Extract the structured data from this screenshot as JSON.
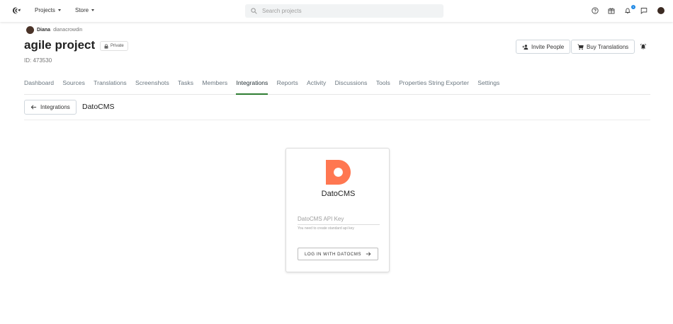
{
  "topbar": {
    "menus": [
      {
        "label": "Projects"
      },
      {
        "label": "Store"
      }
    ],
    "search": {
      "placeholder": "Search projects",
      "value": ""
    },
    "notification_count": "1"
  },
  "project": {
    "owner_name": "Diana",
    "owner_handle": "dianacrowdin",
    "title": "agile project",
    "visibility": "Private",
    "id_text": "ID: 473530"
  },
  "actions": {
    "invite": "Invite People",
    "buy": "Buy Translations"
  },
  "tabs": [
    {
      "label": "Dashboard",
      "active": false
    },
    {
      "label": "Sources",
      "active": false
    },
    {
      "label": "Translations",
      "active": false
    },
    {
      "label": "Screenshots",
      "active": false
    },
    {
      "label": "Tasks",
      "active": false
    },
    {
      "label": "Members",
      "active": false
    },
    {
      "label": "Integrations",
      "active": true
    },
    {
      "label": "Reports",
      "active": false
    },
    {
      "label": "Activity",
      "active": false
    },
    {
      "label": "Discussions",
      "active": false
    },
    {
      "label": "Tools",
      "active": false
    },
    {
      "label": "Properties String Exporter",
      "active": false
    },
    {
      "label": "Settings",
      "active": false
    }
  ],
  "integration": {
    "back_label": "Integrations",
    "title": "DatoCMS",
    "card_title": "DatoCMS",
    "api_key_placeholder": "DatoCMS API Key",
    "api_key_value": "",
    "hint": "You need to create standard api key",
    "login_label": "LOG IN WITH DATOCMS"
  },
  "colors": {
    "active_tab": "#2e7d32",
    "dato_brand": "#ff7751",
    "badge": "#1e88e5"
  }
}
